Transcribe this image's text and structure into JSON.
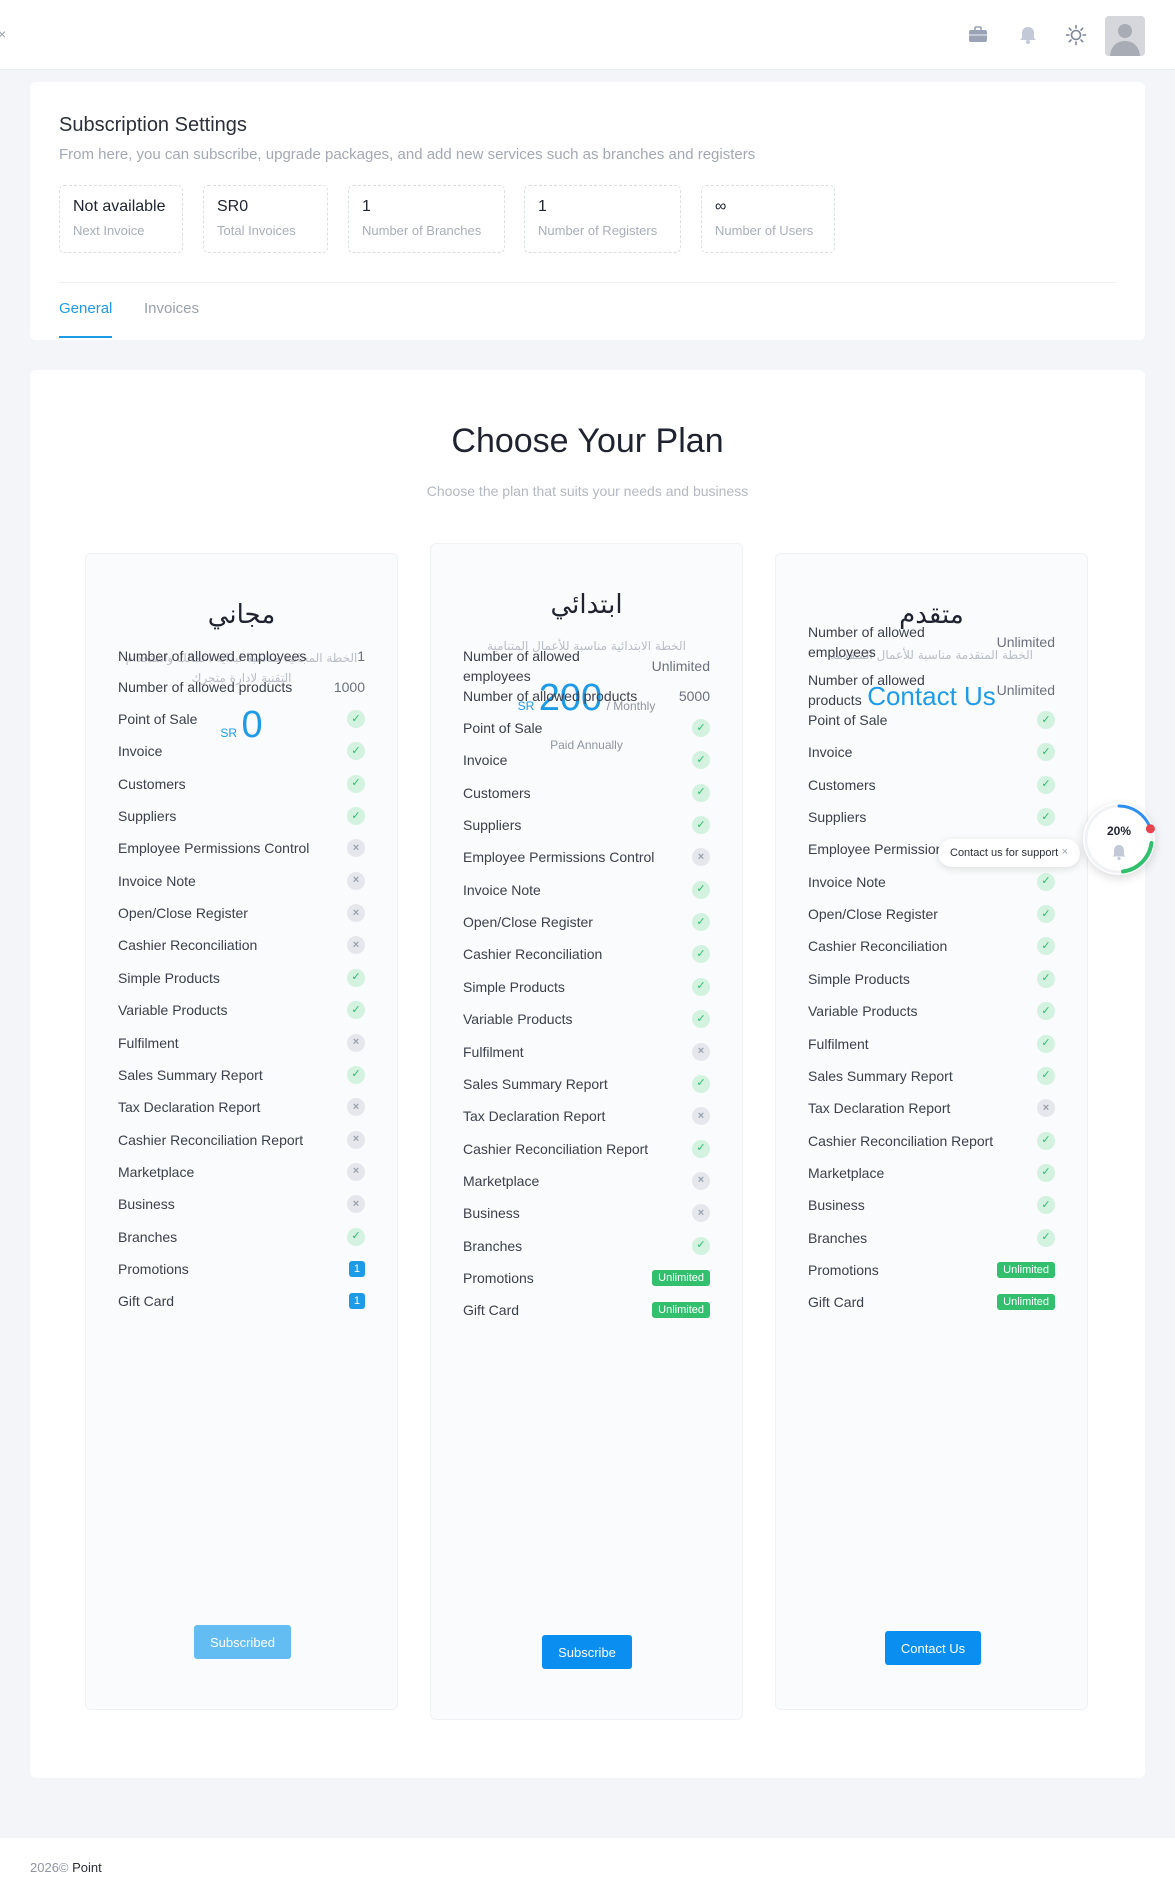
{
  "topbar": {
    "icons": [
      "briefcase-icon",
      "bell-icon",
      "sun-icon"
    ],
    "avatar": "user-avatar"
  },
  "settings": {
    "title": "Subscription Settings",
    "subtitle": "From here, you can subscribe, upgrade packages, and add new services such as branches and registers",
    "stats": [
      {
        "value": "Not available",
        "label": "Next Invoice"
      },
      {
        "value": "SR0",
        "label": "Total Invoices"
      },
      {
        "value": "1",
        "label": "Number of Branches"
      },
      {
        "value": "1",
        "label": "Number of Registers"
      },
      {
        "value": "∞",
        "label": "Number of Users"
      }
    ],
    "tabs": [
      "General",
      "Invoices"
    ]
  },
  "plans_section": {
    "title": "Choose Your Plan",
    "subtitle": "Choose the plan that suits your needs and business"
  },
  "plans": [
    {
      "name": "مجاني",
      "description": "الخطة المجانية مناسبة لبداية اعمالك واستخدام التقنية لادارة متجرك",
      "currency": "SR",
      "price": "0",
      "features": [
        {
          "label": "Number of allowed employees",
          "value": "1"
        },
        {
          "label": "Number of allowed products",
          "value": "1000"
        },
        {
          "label": "Point of Sale",
          "status": "yes"
        },
        {
          "label": "Invoice",
          "status": "yes"
        },
        {
          "label": "Customers",
          "status": "yes"
        },
        {
          "label": "Suppliers",
          "status": "yes"
        },
        {
          "label": "Employee Permissions Control",
          "status": "no"
        },
        {
          "label": "Invoice Note",
          "status": "no"
        },
        {
          "label": "Open/Close Register",
          "status": "no"
        },
        {
          "label": "Cashier Reconciliation",
          "status": "no"
        },
        {
          "label": "Simple Products",
          "status": "yes"
        },
        {
          "label": "Variable Products",
          "status": "yes"
        },
        {
          "label": "Fulfilment",
          "status": "no"
        },
        {
          "label": "Sales Summary Report",
          "status": "yes"
        },
        {
          "label": "Tax Declaration Report",
          "status": "no"
        },
        {
          "label": "Cashier Reconciliation Report",
          "status": "no"
        },
        {
          "label": "Marketplace",
          "status": "no"
        },
        {
          "label": "Business",
          "status": "no"
        },
        {
          "label": "Branches",
          "status": "yes"
        },
        {
          "label": "Promotions",
          "badge": "1"
        },
        {
          "label": "Gift Card",
          "badge": "1"
        }
      ],
      "button": "Subscribed"
    },
    {
      "name": "ابتدائي",
      "description": "الخطة الابتدائية مناسبة للأعمال المتنامية",
      "currency": "SR",
      "price": "200",
      "period": "/ Monthly",
      "billed": "Paid Annually",
      "features": [
        {
          "label": "Number of allowed employees",
          "value": "Unlimited"
        },
        {
          "label": "Number of allowed products",
          "value": "5000"
        },
        {
          "label": "Point of Sale",
          "status": "yes"
        },
        {
          "label": "Invoice",
          "status": "yes"
        },
        {
          "label": "Customers",
          "status": "yes"
        },
        {
          "label": "Suppliers",
          "status": "yes"
        },
        {
          "label": "Employee Permissions Control",
          "status": "no"
        },
        {
          "label": "Invoice Note",
          "status": "yes"
        },
        {
          "label": "Open/Close Register",
          "status": "yes"
        },
        {
          "label": "Cashier Reconciliation",
          "status": "yes"
        },
        {
          "label": "Simple Products",
          "status": "yes"
        },
        {
          "label": "Variable Products",
          "status": "yes"
        },
        {
          "label": "Fulfilment",
          "status": "no"
        },
        {
          "label": "Sales Summary Report",
          "status": "yes"
        },
        {
          "label": "Tax Declaration Report",
          "status": "no"
        },
        {
          "label": "Cashier Reconciliation Report",
          "status": "yes"
        },
        {
          "label": "Marketplace",
          "status": "no"
        },
        {
          "label": "Business",
          "status": "no"
        },
        {
          "label": "Branches",
          "status": "yes"
        },
        {
          "label": "Promotions",
          "badge": "Unlimited"
        },
        {
          "label": "Gift Card",
          "badge": "Unlimited"
        }
      ],
      "button": "Subscribe"
    },
    {
      "name": "متقدم",
      "description": "الخطة المتقدمة مناسبة للأعمال المتقدمة",
      "contact_label": "Contact Us",
      "features": [
        {
          "label": "Number of allowed employees",
          "value": "Unlimited"
        },
        {
          "label": "Number of allowed products",
          "value": "Unlimited"
        },
        {
          "label": "Point of Sale",
          "status": "yes"
        },
        {
          "label": "Invoice",
          "status": "yes"
        },
        {
          "label": "Customers",
          "status": "yes"
        },
        {
          "label": "Suppliers",
          "status": "yes"
        },
        {
          "label": "Employee Permissions Control",
          "status": "no"
        },
        {
          "label": "Invoice Note",
          "status": "yes"
        },
        {
          "label": "Open/Close Register",
          "status": "yes"
        },
        {
          "label": "Cashier Reconciliation",
          "status": "yes"
        },
        {
          "label": "Simple Products",
          "status": "yes"
        },
        {
          "label": "Variable Products",
          "status": "yes"
        },
        {
          "label": "Fulfilment",
          "status": "yes"
        },
        {
          "label": "Sales Summary Report",
          "status": "yes"
        },
        {
          "label": "Tax Declaration Report",
          "status": "no"
        },
        {
          "label": "Cashier Reconciliation Report",
          "status": "yes"
        },
        {
          "label": "Marketplace",
          "status": "yes"
        },
        {
          "label": "Business",
          "status": "yes"
        },
        {
          "label": "Branches",
          "status": "yes"
        },
        {
          "label": "Promotions",
          "badge": "Unlimited"
        },
        {
          "label": "Gift Card",
          "badge": "Unlimited"
        }
      ],
      "button": "Contact Us"
    }
  ],
  "support_widget": {
    "label": "Contact us for support",
    "close": "×",
    "progress": "20%",
    "progress_value": 0.2,
    "colors": {
      "ring": "#2f8ff0",
      "dot": "#e8434f",
      "accent": "#33c06e"
    }
  },
  "footer": {
    "year": "2026©",
    "brand": "Point"
  },
  "colors": {
    "accent": "#1e9be6",
    "success": "#33c06e",
    "muted": "#a3a8b5"
  }
}
